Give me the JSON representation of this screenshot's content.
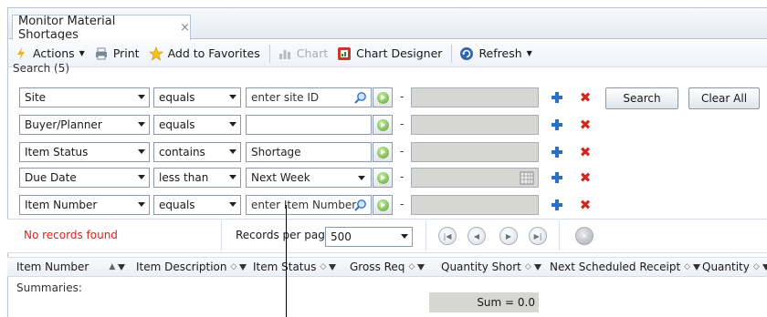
{
  "tab": {
    "title": "Monitor Material Shortages",
    "close": "×"
  },
  "toolbar": {
    "actions": "Actions",
    "print": "Print",
    "favorites": "Add to Favorites",
    "chart": "Chart",
    "chart_designer": "Chart Designer",
    "refresh": "Refresh"
  },
  "search": {
    "label": "Search (5)",
    "rows": [
      {
        "field": "Site",
        "operator": "equals",
        "value": "enter site ID"
      },
      {
        "field": "Buyer/Planner",
        "operator": "equals",
        "value": ""
      },
      {
        "field": "Item Status",
        "operator": "contains",
        "value": "Shortage"
      },
      {
        "field": "Due Date",
        "operator": "less than",
        "value": "Next Week"
      },
      {
        "field": "Item Number",
        "operator": "equals",
        "value": "enter Item Number"
      }
    ],
    "dash": "-",
    "search_button": "Search",
    "clear_button": "Clear All"
  },
  "status": {
    "no_records": "No records found",
    "records_per_page_label": "Records per page:",
    "records_per_page_value": "500"
  },
  "columns": [
    "Item Number",
    "Item Description",
    "Item Status",
    "Gross Req",
    "Quantity Short",
    "Next Scheduled Receipt",
    "Quantity"
  ],
  "summaries": {
    "label": "Summaries:",
    "sum": "Sum = 0.0"
  },
  "colors": {
    "error_text": "#e02020",
    "accent_blue": "#2d6fc8",
    "delete_red": "#d02a1f",
    "disabled_field": "#d6d6d2"
  }
}
